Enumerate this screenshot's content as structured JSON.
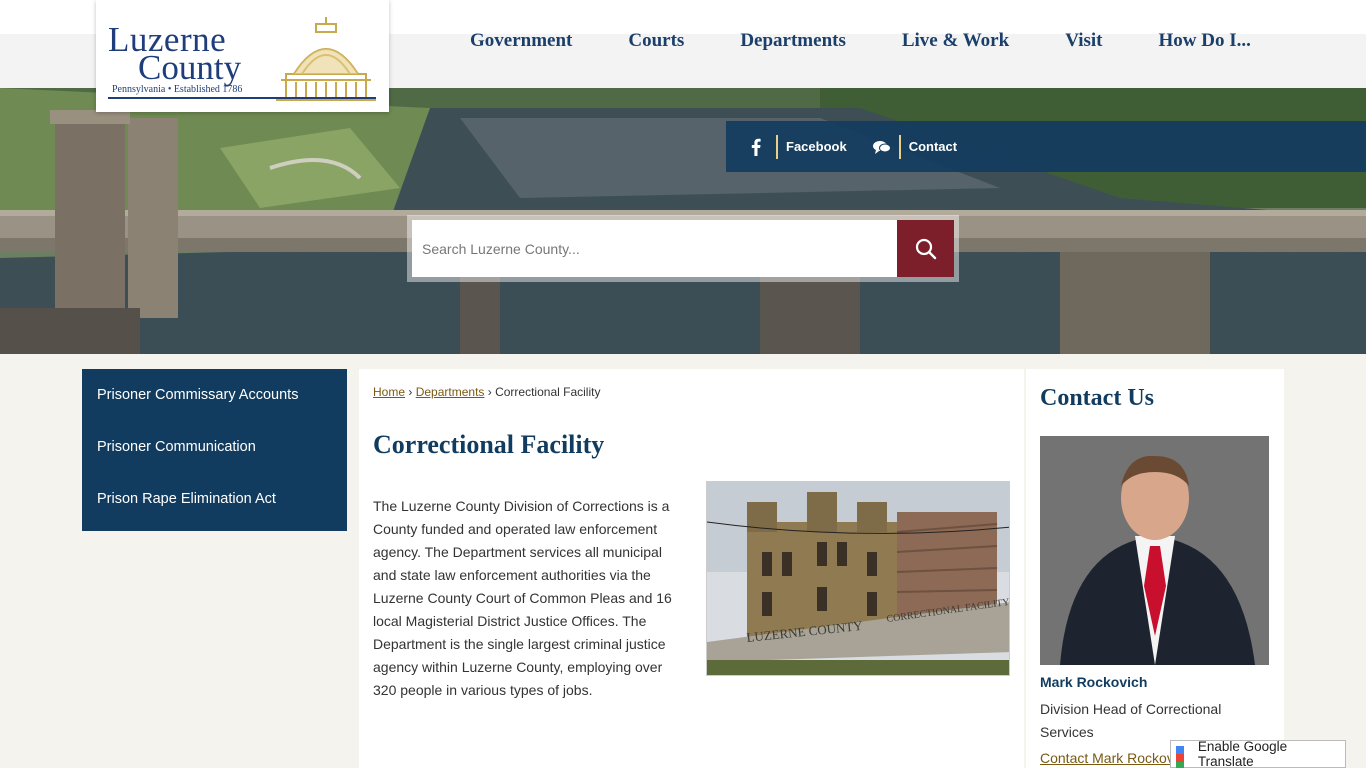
{
  "logo": {
    "line1": "Luzerne",
    "line2": "County",
    "tagline": "Pennsylvania • Established 1786"
  },
  "nav": {
    "items": [
      "Government",
      "Courts",
      "Departments",
      "Live & Work",
      "Visit",
      "How Do I..."
    ]
  },
  "social": {
    "facebook": "Facebook",
    "contact": "Contact"
  },
  "search": {
    "placeholder": "Search Luzerne County..."
  },
  "sidebar": {
    "items": [
      "Prisoner Commissary Accounts",
      "Prisoner Communication",
      "Prison Rape Elimination Act"
    ]
  },
  "breadcrumb": {
    "home": "Home",
    "departments": "Departments",
    "current": "Correctional Facility",
    "separator": "›"
  },
  "main": {
    "title": "Correctional Facility",
    "body": "The Luzerne County Division of Corrections is a County funded and operated law enforcement agency. The Department services all municipal and state law enforcement authorities via the Luzerne County Court of Common Pleas and 16 local Magisterial District Justice Offices. The Department is the single largest criminal justice agency within Luzerne County, employing over 320 people in various types of jobs.",
    "image_caption_sign1": "LUZERNE COUNTY",
    "image_caption_sign2": "CORRECTIONAL FACILITY"
  },
  "contact": {
    "title": "Contact Us",
    "name": "Mark Rockovich",
    "role": "Division Head of Correctional Services",
    "link": "Contact Mark Rockovich"
  },
  "translate": {
    "label": "Enable Google Translate"
  },
  "colors": {
    "navy": "#123c5f",
    "maroon": "#7c1f2b",
    "gold": "#e7d08a",
    "link": "#7a5a12"
  },
  "icons": {
    "facebook": "facebook-icon",
    "contact": "chat-bubbles-icon",
    "search": "search-icon",
    "translate": "google-translate-icon"
  }
}
